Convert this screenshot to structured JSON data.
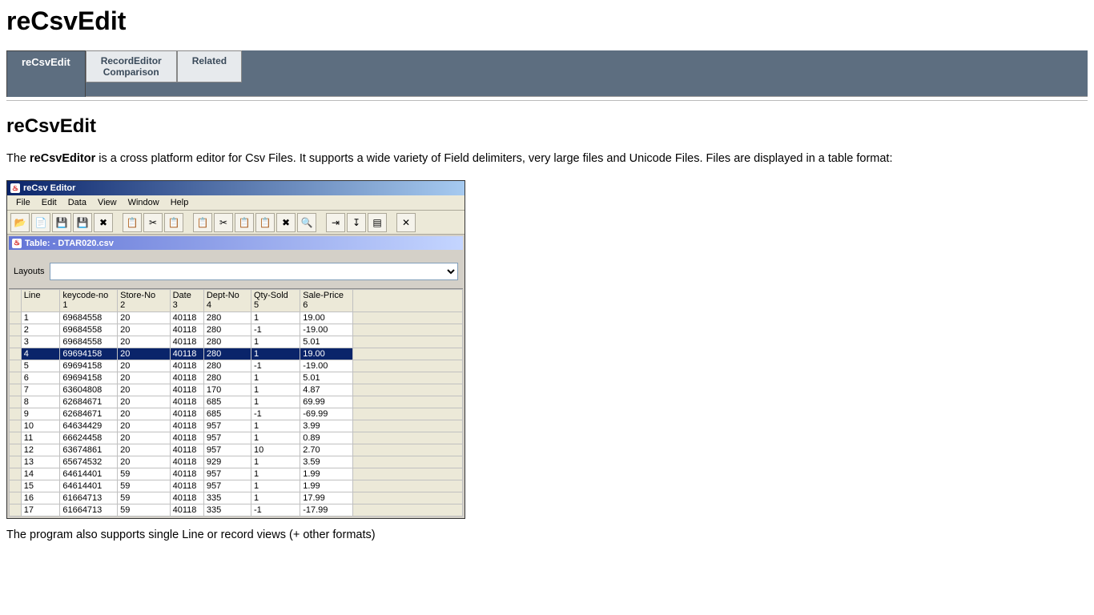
{
  "page": {
    "title": "reCsvEdit",
    "section_title": "reCsvEdit",
    "intro_pre": "The ",
    "intro_bold": "reCsvEditor",
    "intro_post": " is a cross platform editor for Csv Files. It supports a wide variety of Field delimiters, very large files and Unicode Files. Files are displayed in a table format:",
    "after_text": "The program also supports single Line or record views (+ other formats)"
  },
  "tabs": [
    {
      "label": "reCsvEdit",
      "active": true
    },
    {
      "label": "RecordEditor Comparison",
      "active": false
    },
    {
      "label": "Related",
      "active": false
    }
  ],
  "app": {
    "window_title": "reCsv Editor",
    "menu": [
      "File",
      "Edit",
      "Data",
      "View",
      "Window",
      "Help"
    ],
    "toolbar_icons": [
      "open-folder-icon",
      "new-file-icon",
      "save-icon",
      "save-as-icon",
      "delete-x-icon",
      "sep",
      "copy-icon",
      "cut-icon",
      "paste-icon",
      "sep",
      "copy2-icon",
      "cut2-icon",
      "paste2-icon",
      "paste-new-icon",
      "close-x-icon",
      "find-icon",
      "sep",
      "filter-icon",
      "sort-icon",
      "view-icon",
      "sep",
      "settings-icon"
    ],
    "sub_window_title": "Table:  - DTAR020.csv",
    "layouts_label": "Layouts",
    "columns": [
      {
        "name": "Line",
        "sub": ""
      },
      {
        "name": "keycode-no",
        "sub": "1"
      },
      {
        "name": "Store-No",
        "sub": "2"
      },
      {
        "name": "Date",
        "sub": "3"
      },
      {
        "name": "Dept-No",
        "sub": "4"
      },
      {
        "name": "Qty-Sold",
        "sub": "5"
      },
      {
        "name": "Sale-Price",
        "sub": "6"
      }
    ],
    "selected_row_index": 3,
    "rows": [
      [
        "1",
        "69684558",
        "20",
        "40118",
        "280",
        "1",
        "19.00"
      ],
      [
        "2",
        "69684558",
        "20",
        "40118",
        "280",
        "-1",
        "-19.00"
      ],
      [
        "3",
        "69684558",
        "20",
        "40118",
        "280",
        "1",
        "5.01"
      ],
      [
        "4",
        "69694158",
        "20",
        "40118",
        "280",
        "1",
        "19.00"
      ],
      [
        "5",
        "69694158",
        "20",
        "40118",
        "280",
        "-1",
        "-19.00"
      ],
      [
        "6",
        "69694158",
        "20",
        "40118",
        "280",
        "1",
        "5.01"
      ],
      [
        "7",
        "63604808",
        "20",
        "40118",
        "170",
        "1",
        "4.87"
      ],
      [
        "8",
        "62684671",
        "20",
        "40118",
        "685",
        "1",
        "69.99"
      ],
      [
        "9",
        "62684671",
        "20",
        "40118",
        "685",
        "-1",
        "-69.99"
      ],
      [
        "10",
        "64634429",
        "20",
        "40118",
        "957",
        "1",
        "3.99"
      ],
      [
        "11",
        "66624458",
        "20",
        "40118",
        "957",
        "1",
        "0.89"
      ],
      [
        "12",
        "63674861",
        "20",
        "40118",
        "957",
        "10",
        "2.70"
      ],
      [
        "13",
        "65674532",
        "20",
        "40118",
        "929",
        "1",
        "3.59"
      ],
      [
        "14",
        "64614401",
        "59",
        "40118",
        "957",
        "1",
        "1.99"
      ],
      [
        "15",
        "64614401",
        "59",
        "40118",
        "957",
        "1",
        "1.99"
      ],
      [
        "16",
        "61664713",
        "59",
        "40118",
        "335",
        "1",
        "17.99"
      ],
      [
        "17",
        "61664713",
        "59",
        "40118",
        "335",
        "-1",
        "-17.99"
      ]
    ]
  },
  "glyphs": {
    "open-folder-icon": "📂",
    "new-file-icon": "📄",
    "save-icon": "💾",
    "save-as-icon": "💾",
    "delete-x-icon": "✖",
    "copy-icon": "📋",
    "cut-icon": "✂",
    "paste-icon": "📋",
    "copy2-icon": "📋",
    "cut2-icon": "✂",
    "paste2-icon": "📋",
    "paste-new-icon": "📋",
    "close-x-icon": "✖",
    "find-icon": "🔍",
    "filter-icon": "⇥",
    "sort-icon": "↧",
    "view-icon": "▤",
    "settings-icon": "✕"
  }
}
